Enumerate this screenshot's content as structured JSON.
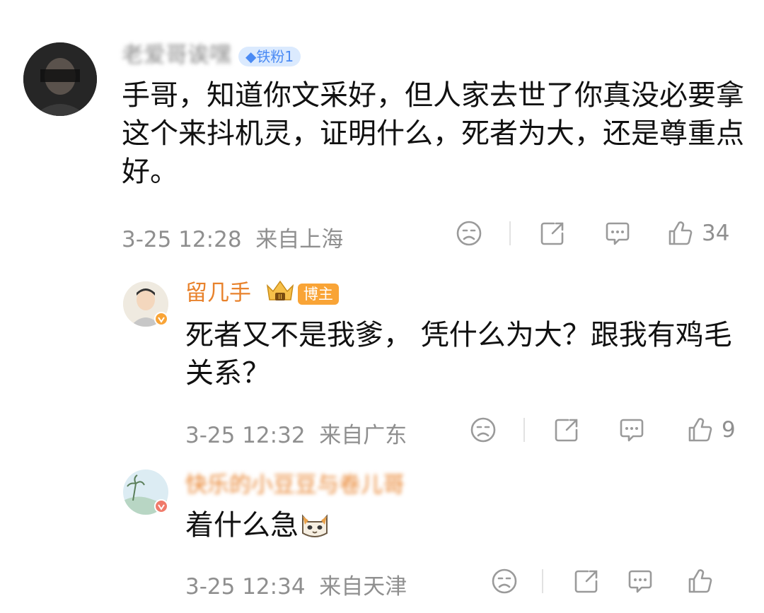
{
  "colors": {
    "background": "#ffffff",
    "text": "#111111",
    "meta": "#8f8f8f",
    "author_name": "#e8822c",
    "host_badge": "#f9a436",
    "fan_badge": "#4a8af4"
  },
  "comments": [
    {
      "user": {
        "name": "老爱哥诶嘿",
        "badge": "◆铁粉1"
      },
      "text": "手哥，知道你文采好，但人家去世了你真没必要拿这个来抖机灵，证明什么，死者为大，还是尊重点好。",
      "time": "3-25 12:28",
      "location": "来自上海",
      "likes": "34"
    },
    {
      "user": {
        "name": "留几手",
        "crown_label": "II",
        "badge": "博主"
      },
      "text": "死者又不是我爹， 凭什么为大？跟我有鸡毛关系？",
      "time": "3-25 12:32",
      "location": "来自广东",
      "likes": "9"
    },
    {
      "user": {
        "name": "快乐的小豆豆与卷儿哥"
      },
      "text": "着什么急",
      "time": "3-25 12:34",
      "location": "来自天津",
      "likes": ""
    }
  ],
  "icons": [
    "emoji-icon",
    "repost-icon",
    "comment-icon",
    "like-icon",
    "cat-emoji-icon",
    "verified-icon"
  ]
}
